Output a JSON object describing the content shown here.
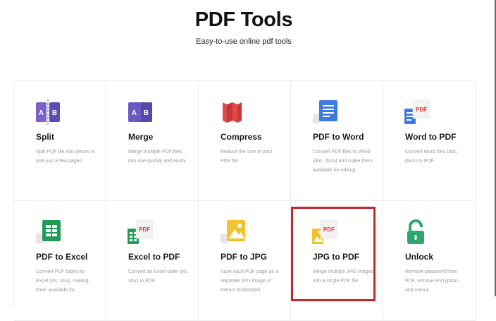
{
  "header": {
    "title": "PDF Tools",
    "subtitle": "Easy-to-use online pdf tools"
  },
  "tools": [
    {
      "name": "Split",
      "icon": "split-icon",
      "description": "Split PDF file into pieces or pick just a few pages"
    },
    {
      "name": "Merge",
      "icon": "merge-icon",
      "description": "Merge multiple PDF files into one quickly and easily"
    },
    {
      "name": "Compress",
      "icon": "compress-icon",
      "description": "Reduce the size of your PDF file"
    },
    {
      "name": "PDF to Word",
      "icon": "word-doc-icon",
      "description": "Convert PDF files to Word (doc, docx) and make them available for editing"
    },
    {
      "name": "Word to PDF",
      "icon": "word-to-pdf-icon",
      "badge": "PDF",
      "description": "Convert Word files (doc, docx) to PDF"
    },
    {
      "name": "PDF to Excel",
      "icon": "excel-sheet-icon",
      "description": "Convert PDF tables to Excel (xls, xlsx), making them available for"
    },
    {
      "name": "Excel to PDF",
      "icon": "excel-to-pdf-icon",
      "badge": "PDF",
      "description": "Convert an Excel table (xls, xlsx) to PDF"
    },
    {
      "name": "PDF to JPG",
      "icon": "jpg-image-icon",
      "description": "Save each PDF page as a separate JPG image or extract embedded"
    },
    {
      "name": "JPG to PDF",
      "icon": "jpg-to-pdf-icon",
      "badge": "PDF",
      "description": "Merge multiple JPG images into a single PDF file"
    },
    {
      "name": "Unlock",
      "icon": "unlock-icon",
      "description": "Remove password from PDF, remove encryption, and unlock"
    }
  ],
  "icon_letters": {
    "a": "A",
    "b": "B"
  },
  "colors": {
    "purple": "#6a5acd",
    "compress_red": "#e24a4a",
    "word_blue": "#3d7be0",
    "excel_green": "#1f9d55",
    "jpg_yellow": "#f2c230",
    "unlock_green": "#2fa66b",
    "highlight": "#c4282b"
  }
}
